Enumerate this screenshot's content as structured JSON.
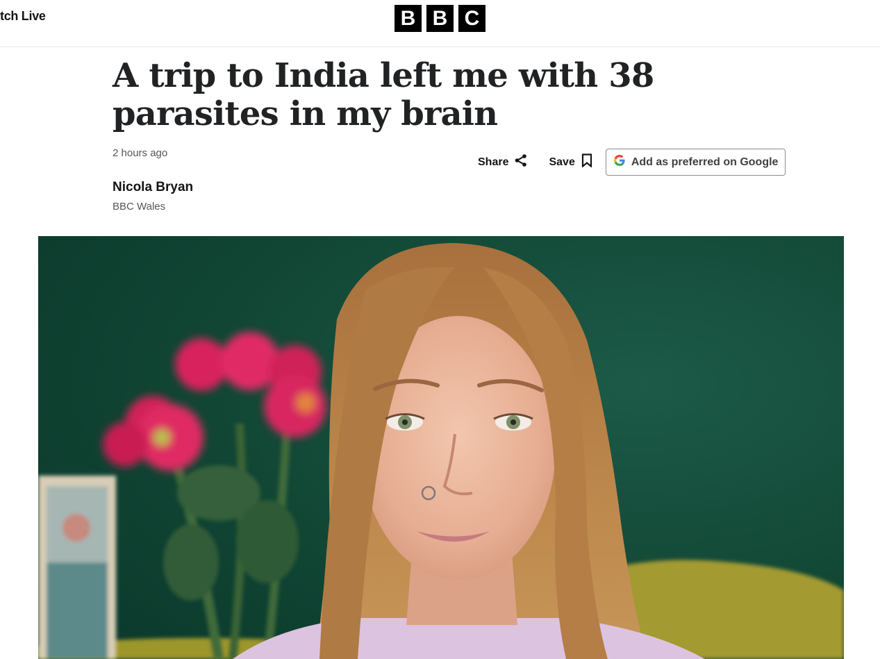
{
  "header": {
    "watch_live_label": "tch Live",
    "logo_letters": [
      "B",
      "B",
      "C"
    ]
  },
  "article": {
    "headline": "A trip to India left me with 38 parasites in my brain",
    "timestamp": "2 hours ago",
    "author_name": "Nicola Bryan",
    "author_org": "BBC Wales"
  },
  "actions": {
    "share_label": "Share",
    "save_label": "Save",
    "google_label": "Add as preferred on Google"
  },
  "icons": {
    "share": "share-icon",
    "save": "bookmark-icon",
    "google": "google-g-icon"
  },
  "colors": {
    "hero_background": "#0f4a3a",
    "sofa": "#a59a2c",
    "flowers": "#d6265f",
    "hair": "#b0743e"
  }
}
